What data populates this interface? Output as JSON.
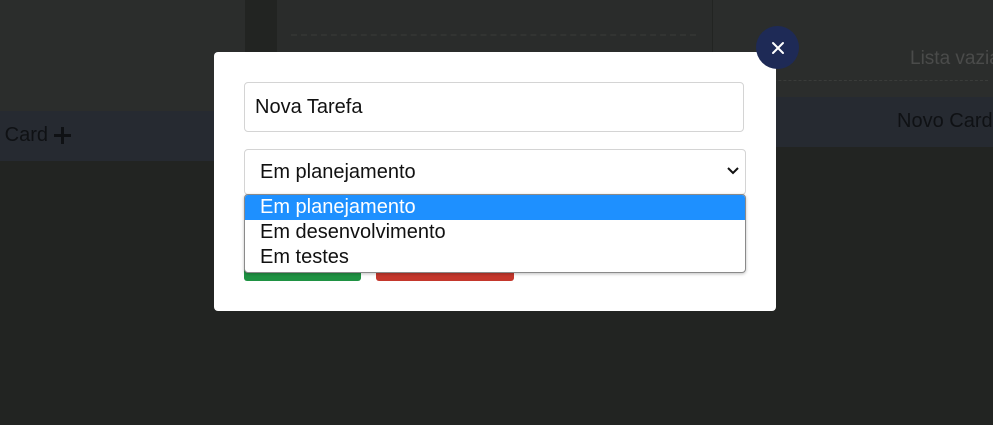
{
  "background_board": {
    "empty_list_text": "Lista vazia",
    "add_card_label_left": "o Card",
    "add_card_label_right": "Novo Card"
  },
  "modal": {
    "title_value": "Nova Tarefa",
    "status_selected": "Em planejamento",
    "status_options": [
      {
        "label": "Em planejamento",
        "selected": true
      },
      {
        "label": "Em desenvolvimento",
        "selected": false
      },
      {
        "label": "Em testes",
        "selected": false
      }
    ],
    "close_icon": "close-icon",
    "colors": {
      "save": "#1f9243",
      "cancel": "#c4372c",
      "close": "#1e2a56",
      "option_highlight": "#1e90ff"
    }
  }
}
